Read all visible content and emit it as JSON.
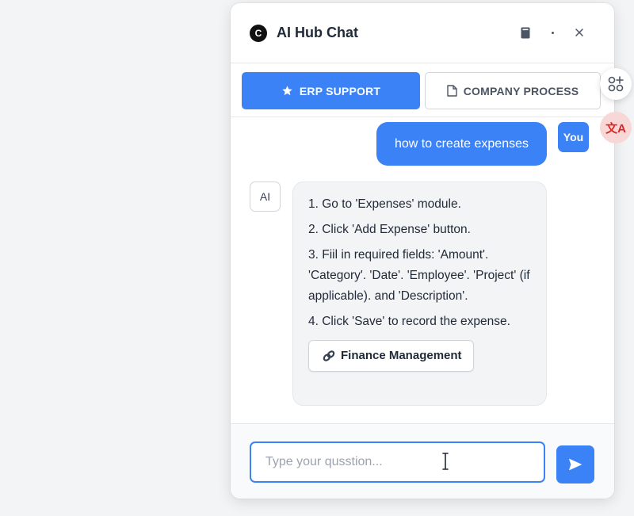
{
  "header": {
    "logo_glyph": "C",
    "title": "AI Hub Chat"
  },
  "tabs": [
    {
      "label": "ERP SUPPORT",
      "icon": "star-icon",
      "active": true
    },
    {
      "label": "COMPANY PROCESS",
      "icon": "document-icon",
      "active": false
    }
  ],
  "messages": {
    "user": {
      "avatar": "You",
      "text": "how to create expenses"
    },
    "ai": {
      "avatar": "AI",
      "steps": [
        "1. Go to 'Expenses' module.",
        "2. Click 'Add Expense' button.",
        "3. Fiil in required fields: 'Amount'. 'Category'. 'Date'. 'Employee'. 'Project' (if applicable). and 'Description'.",
        "4. Click 'Save' to record the expense."
      ],
      "tag_label": "Finance Management"
    }
  },
  "composer": {
    "placeholder": "Type your qusstion..."
  },
  "side": {
    "translate_glyph": "文A"
  },
  "colors": {
    "accent": "#3b82f6",
    "bubble_ai_bg": "#f3f4f6"
  }
}
